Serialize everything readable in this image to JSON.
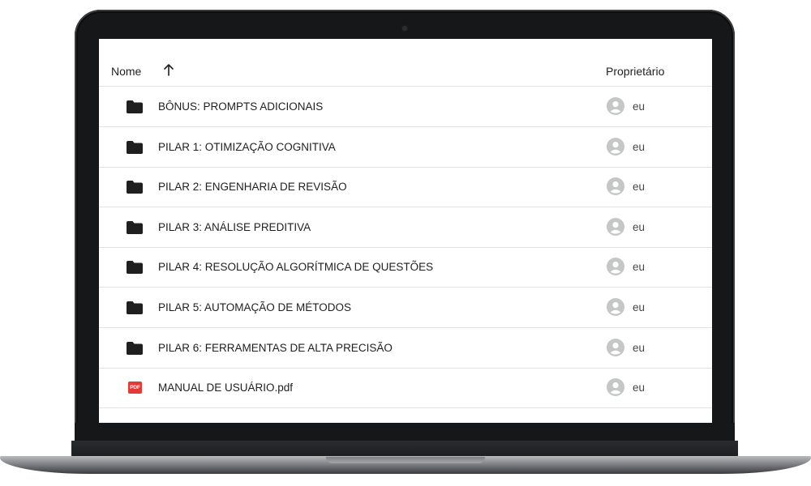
{
  "columns": {
    "name": "Nome",
    "owner": "Proprietário"
  },
  "pdf_badge": "PDF",
  "files": [
    {
      "name": "BÔNUS: PROMPTS ADICIONAIS",
      "type": "folder",
      "owner": "eu"
    },
    {
      "name": "PILAR 1: OTIMIZAÇÃO COGNITIVA",
      "type": "folder",
      "owner": "eu"
    },
    {
      "name": "PILAR 2: ENGENHARIA DE REVISÃO",
      "type": "folder",
      "owner": "eu"
    },
    {
      "name": "PILAR 3: ANÁLISE PREDITIVA",
      "type": "folder",
      "owner": "eu"
    },
    {
      "name": "PILAR 4: RESOLUÇÃO ALGORÍTMICA DE QUESTÕES",
      "type": "folder",
      "owner": "eu"
    },
    {
      "name": "PILAR 5: AUTOMAÇÃO DE MÉTODOS",
      "type": "folder",
      "owner": "eu"
    },
    {
      "name": "PILAR 6: FERRAMENTAS DE ALTA PRECISÃO",
      "type": "folder",
      "owner": "eu"
    },
    {
      "name": "MANUAL DE USUÁRIO.pdf",
      "type": "pdf",
      "owner": "eu"
    }
  ],
  "colors": {
    "folder": "#1f1f1f",
    "pdf": "#e53935",
    "avatar": "#c4c7c5",
    "divider": "#e3e3e3"
  }
}
